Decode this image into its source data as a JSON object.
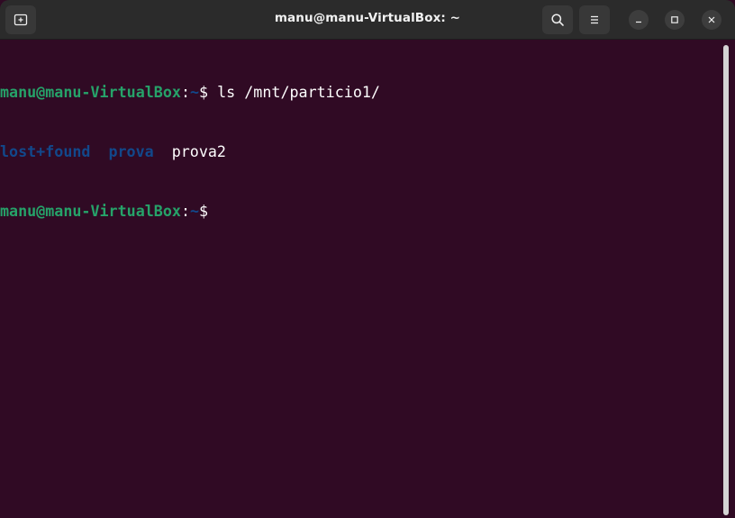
{
  "window": {
    "title": "manu@manu-VirtualBox: ~"
  },
  "header": {
    "new_tab_icon": "new-tab-icon",
    "search_icon": "search-icon",
    "menu_icon": "hamburger-menu-icon",
    "minimize_icon": "minimize-icon",
    "maximize_icon": "maximize-icon",
    "close_icon": "close-icon"
  },
  "terminal": {
    "line1": {
      "user_host": "manu@manu-VirtualBox",
      "sep": ":",
      "path": "~",
      "prompt_and_command": "$ ls /mnt/particio1/"
    },
    "line2": {
      "entries": [
        "lost+found",
        "prova",
        "prova2"
      ]
    },
    "line3": {
      "user_host": "manu@manu-VirtualBox",
      "sep": ":",
      "path": "~",
      "prompt": "$"
    }
  },
  "colors": {
    "background": "#300a24",
    "titlebar": "#2b2b2b",
    "prompt_user": "#26a269",
    "prompt_path": "#12488b",
    "directory": "#12488b",
    "text": "#ffffff"
  }
}
